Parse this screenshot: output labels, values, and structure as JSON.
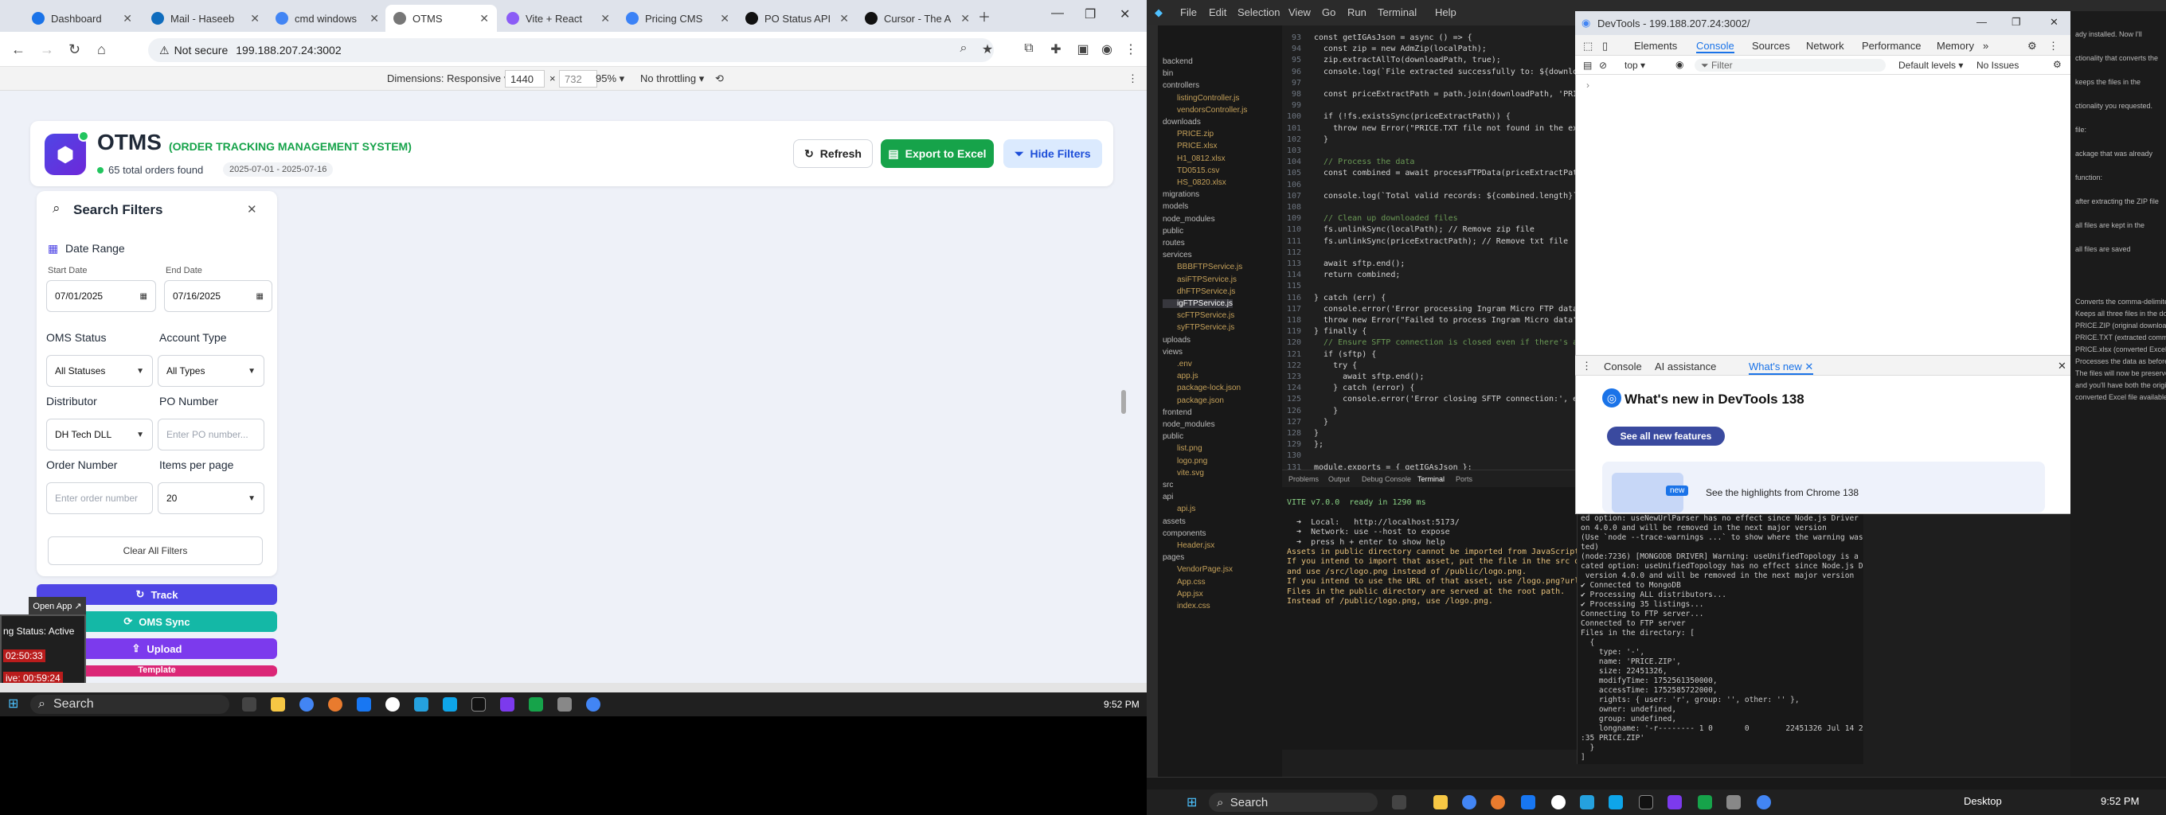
{
  "browser": {
    "tabs": [
      {
        "label": "Dashboard",
        "color": "#1a73e8"
      },
      {
        "label": "Mail - Haseeb",
        "color": "#0f6cbd"
      },
      {
        "label": "cmd windows",
        "color": "#4285f4"
      },
      {
        "label": "OTMS",
        "color": "#777777"
      },
      {
        "label": "Vite + React",
        "color": "#8b5cf6"
      },
      {
        "label": "Pricing CMS",
        "color": "#3b82f6"
      },
      {
        "label": "PO Status API",
        "color": "#111111"
      },
      {
        "label": "Cursor - The A",
        "color": "#111111"
      }
    ],
    "not_secure": "Not secure",
    "url": "199.188.207.24:3002",
    "devbar": {
      "dimensions_label": "Dimensions: Responsive",
      "width": "1440",
      "height": "732",
      "zoom": "95%",
      "throttle": "No throttling"
    }
  },
  "app": {
    "title": "OTMS",
    "subtitle": "(ORDER TRACKING MANAGEMENT SYSTEM)",
    "orders_found": "65 total orders found",
    "date_range": "2025-07-01 - 2025-07-16",
    "buttons": {
      "refresh": "Refresh",
      "export": "Export to Excel",
      "hide_filters": "Hide Filters"
    },
    "filters": {
      "title": "Search Filters",
      "date_range": "Date Range",
      "start_date_label": "Start Date",
      "start_date": "07/01/2025",
      "end_date_label": "End Date",
      "end_date": "07/16/2025",
      "oms_status_label": "OMS Status",
      "oms_status": "All Statuses",
      "account_type_label": "Account Type",
      "account_type": "All Types",
      "distributor_label": "Distributor",
      "distributor": "DH Tech DLL",
      "po_number_label": "PO Number",
      "po_number_placeholder": "Enter PO number...",
      "order_number_label": "Order Number",
      "order_number_placeholder": "Enter order number",
      "items_per_page_label": "Items per page",
      "items_per_page": "20",
      "clear_all": "Clear All Filters"
    },
    "actions": {
      "track": "Track",
      "oms_sync": "OMS Sync",
      "upload": "Upload",
      "template": "Template"
    },
    "colors": {
      "primary": "#4f46e5",
      "success": "#16a34a",
      "teal": "#14b8a6",
      "purple": "#7c3aed",
      "pink": "#db2777"
    }
  },
  "overlay": {
    "open_app": "Open App ↗",
    "status_active": "ng Status: Active",
    "time1": "02:50:33",
    "time2": "ive: 00:59:24"
  },
  "taskbar_left": {
    "search": "Search",
    "time": "9:52 PM"
  },
  "vscode": {
    "menu": [
      "File",
      "Edit",
      "Selection",
      "View",
      "Go",
      "Run",
      "Terminal",
      "Help"
    ],
    "explorer": [
      "backend",
      "bin",
      "controllers",
      "listingController.js",
      "vendorsController.js",
      "downloads",
      "PRICE.zip",
      "PRICE.xlsx",
      "H1_0812.xlsx",
      "TD0515.csv",
      "HS_0820.xlsx",
      "migrations",
      "models",
      "node_modules",
      "public",
      "routes",
      "services",
      "BBBFTPService.js",
      "asiFTPService.js",
      "dhFTPService.js",
      "igFTPService.js",
      "scFTPService.js",
      "syFTPService.js",
      "uploads",
      "views",
      ".env",
      "app.js",
      "package-lock.json",
      "package.json",
      "frontend",
      "node_modules",
      "public",
      "list.png",
      "logo.png",
      "vite.svg",
      "src",
      "api",
      "api.js",
      "assets",
      "components",
      "Header.jsx",
      "pages",
      "VendorPage.jsx",
      "App.css",
      "App.jsx",
      "index.css"
    ],
    "code": [
      {
        "n": "93",
        "t": "const getIGAsJson = async () => {"
      },
      {
        "n": "94",
        "t": "  const zip = new AdmZip(localPath);"
      },
      {
        "n": "95",
        "t": "  zip.extractAllTo(downloadPath, true);"
      },
      {
        "n": "96",
        "t": "  console.log(`File extracted successfully to: ${downloadPath}`);"
      },
      {
        "n": "97",
        "t": ""
      },
      {
        "n": "98",
        "t": "  const priceExtractPath = path.join(downloadPath, 'PRICE.TXT');"
      },
      {
        "n": "99",
        "t": ""
      },
      {
        "n": "100",
        "t": "  if (!fs.existsSync(priceExtractPath)) {"
      },
      {
        "n": "101",
        "t": "    throw new Error(\"PRICE.TXT file not found in the extracted\");"
      },
      {
        "n": "102",
        "t": "  }"
      },
      {
        "n": "103",
        "t": ""
      },
      {
        "n": "104",
        "t": "  // Process the data"
      },
      {
        "n": "105",
        "t": "  const combined = await processFTPData(priceExtractPath);"
      },
      {
        "n": "106",
        "t": ""
      },
      {
        "n": "107",
        "t": "  console.log(`Total valid records: ${combined.length}`);"
      },
      {
        "n": "108",
        "t": ""
      },
      {
        "n": "109",
        "t": "  // Clean up downloaded files"
      },
      {
        "n": "110",
        "t": "  fs.unlinkSync(localPath); // Remove zip file"
      },
      {
        "n": "111",
        "t": "  fs.unlinkSync(priceExtractPath); // Remove txt file"
      },
      {
        "n": "112",
        "t": ""
      },
      {
        "n": "113",
        "t": "  await sftp.end();"
      },
      {
        "n": "114",
        "t": "  return combined;"
      },
      {
        "n": "115",
        "t": ""
      },
      {
        "n": "116",
        "t": "} catch (err) {"
      },
      {
        "n": "117",
        "t": "  console.error('Error processing Ingram Micro FTP data:', err);"
      },
      {
        "n": "118",
        "t": "  throw new Error(\"Failed to process Ingram Micro data\");"
      },
      {
        "n": "119",
        "t": "} finally {"
      },
      {
        "n": "120",
        "t": "  // Ensure SFTP connection is closed even if there's an error"
      },
      {
        "n": "121",
        "t": "  if (sftp) {"
      },
      {
        "n": "122",
        "t": "    try {"
      },
      {
        "n": "123",
        "t": "      await sftp.end();"
      },
      {
        "n": "124",
        "t": "    } catch (error) {"
      },
      {
        "n": "125",
        "t": "      console.error('Error closing SFTP connection:', error);"
      },
      {
        "n": "126",
        "t": "    }"
      },
      {
        "n": "127",
        "t": "  }"
      },
      {
        "n": "128",
        "t": "}"
      },
      {
        "n": "129",
        "t": "};"
      },
      {
        "n": "130",
        "t": ""
      },
      {
        "n": "131",
        "t": "module.exports = { getIGAsJson };"
      }
    ],
    "term_tabs": [
      "Problems",
      "Output",
      "Debug Console",
      "Terminal",
      "Ports"
    ],
    "term1": [
      "VITE v7.0.0  ready in 1290 ms",
      "",
      "  ➜  Local:   http://localhost:5173/",
      "  ➜  Network: use --host to expose",
      "  ➜  press h + enter to show help",
      "Assets in public directory cannot be imported from JavaScript.",
      "If you intend to import that asset, put the file in the src directory,",
      "and use /src/logo.png instead of /public/logo.png.",
      "If you intend to use the URL of that asset, use /logo.png?url.",
      "Files in the public directory are served at the root path.",
      "Instead of /public/logo.png, use /logo.png."
    ],
    "term2": [
      "ed option: useNewUrlParser has no effect since Node.js Driver versi",
      "on 4.0.0 and will be removed in the next major version",
      "(Use `node --trace-warnings ...` to show where the warning was crea",
      "ted)",
      "(node:7236) [MONGODB DRIVER] Warning: useUnifiedTopology is a depre",
      "cated option: useUnifiedTopology has no effect since Node.js Driver",
      " version 4.0.0 and will be removed in the next major version",
      "✔ Connected to MongoDB",
      "✔ Processing ALL distributors...",
      "✔ Processing 35 listings...",
      "Connecting to FTP server...",
      "Connected to FTP server",
      "Files in the directory: [",
      "  {",
      "    type: '-',",
      "    name: 'PRICE.ZIP',",
      "    size: 22451326,",
      "    modifyTime: 1752561350000,",
      "    accessTime: 1752585722000,",
      "    rights: { user: 'r', group: '', other: '' },",
      "    owner: undefined,",
      "    group: undefined,",
      "    longname: '-r-------- 1 0       0        22451326 Jul 14 22",
      ":35 PRICE.ZIP'",
      "  }",
      "]"
    ]
  },
  "devtools": {
    "title": "DevTools - 199.188.207.24:3002/",
    "tabs": [
      "Elements",
      "Console",
      "Sources",
      "Network",
      "Performance",
      "Memory"
    ],
    "context": "top",
    "filter": "Filter",
    "levels": "Default levels",
    "issues": "No Issues",
    "drawer_tabs": [
      "Console",
      "AI assistance",
      "What's new"
    ],
    "whats_new_title": "What's new in DevTools 138",
    "see_all": "See all new features",
    "highlights": "See the highlights from Chrome 138",
    "new_badge": "new"
  },
  "copilot": {
    "lines": [
      "ady installed. Now I'll",
      "ctionality that converts the",
      "keeps the files in the",
      "ctionality you requested.",
      "file:",
      "ackage that was already",
      "function:",
      "after extracting the ZIP file",
      "all files are kept in the",
      "all files are saved",
      "Converts the comma-delimited PRICE.TXT to PRICE.xlsx",
      "Keeps all three files in the downloads directory:",
      "PRICE.ZIP (original downloaded file)",
      "PRICE.TXT (extracted comma-delimited file)",
      "PRICE.xlsx (converted Excel file)",
      "Processes the data as before and returns the JSON data",
      "The files will now be preserved in the backend/downloads/ directory,",
      "and you'll have both the original comma-delimited text file and the",
      "converted Excel file available for use."
    ]
  },
  "taskbar_right": {
    "search": "Search",
    "desktop": "Desktop",
    "time": "9:52 PM"
  }
}
